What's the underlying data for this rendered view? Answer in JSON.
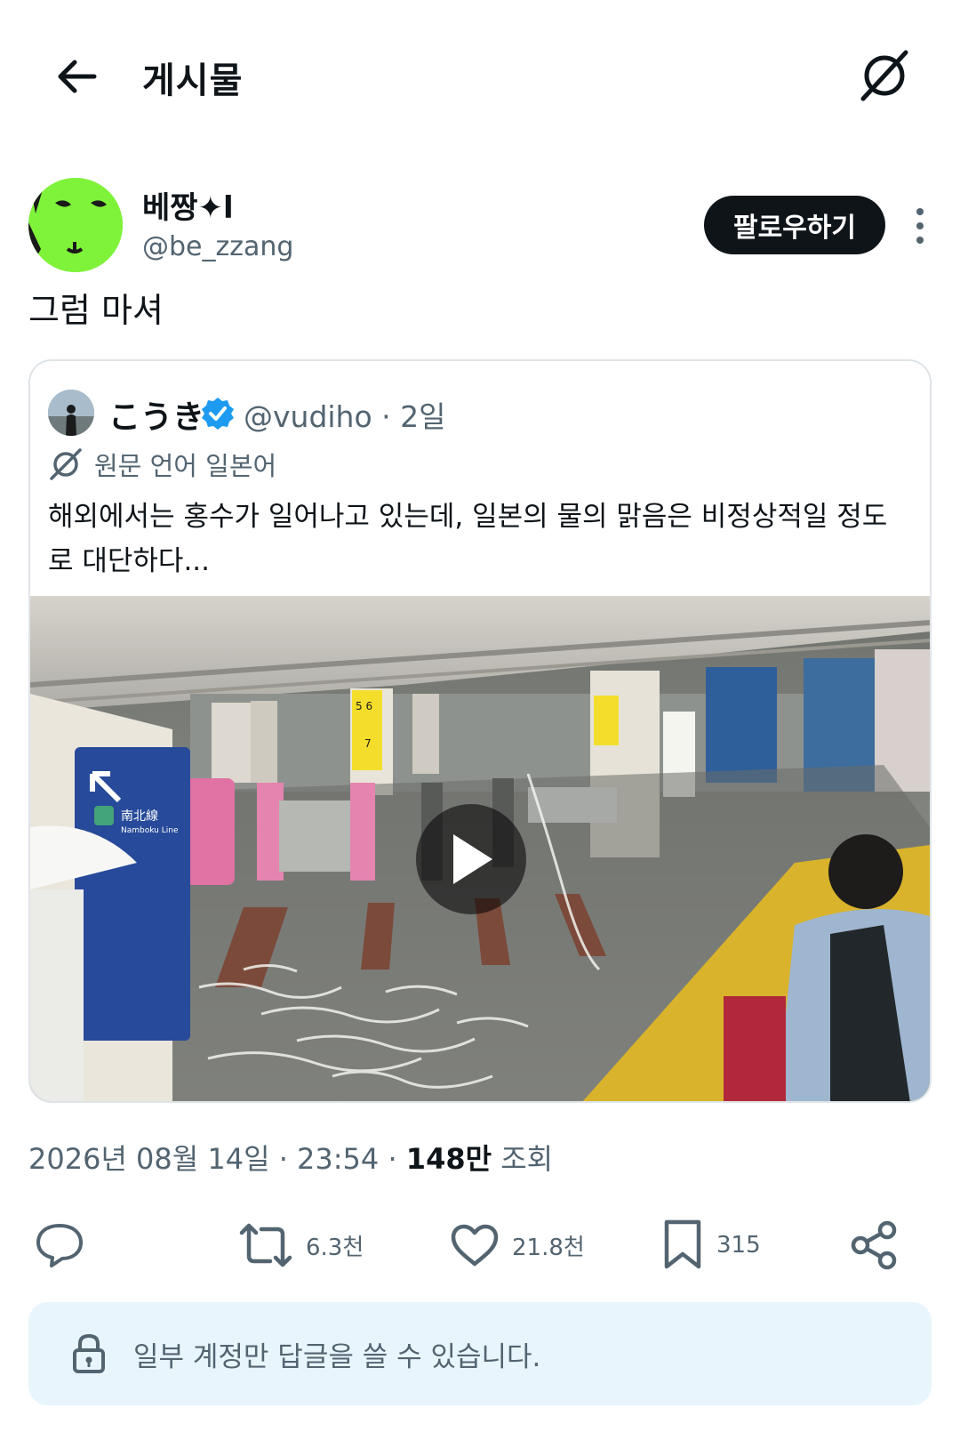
{
  "header": {
    "title": "게시물",
    "back_icon": "arrow-left-icon",
    "translate_icon": "translate-icon"
  },
  "post": {
    "author_name": "베짱✦l",
    "author_handle": "@be_zzang",
    "follow_label": "팔로우하기",
    "text": "그럼 마셔"
  },
  "quote": {
    "name": "こうき",
    "handle_time": "@vudiho · 2일",
    "translate_label": "원문 언어 일본어",
    "text": "해외에서는 홍수가 일어나고 있는데, 일본의 물의 맑음은 비정상적일 정도로 대단하다...",
    "video_sign_top": "5 6",
    "video_sign_bottom": "7",
    "video_pillar_kanji": "南北線",
    "video_pillar_sub": "Namboku Line"
  },
  "meta": {
    "datetime": "2026년 08월 14일 · 23:54 ·",
    "views_count": "148만",
    "views_label": "조회"
  },
  "actions": {
    "retweet_count": "6.3천",
    "like_count": "21.8천",
    "bookmark_count": "315"
  },
  "reply_notice": {
    "text": "일부 계정만 답글을 쓸 수 있습니다."
  },
  "colors": {
    "primary_text": "#0f1419",
    "secondary_text": "#536471",
    "verified": "#1d9bf0",
    "notice_bg": "#e8f5fd",
    "avatar_green": "#7ff23a"
  }
}
